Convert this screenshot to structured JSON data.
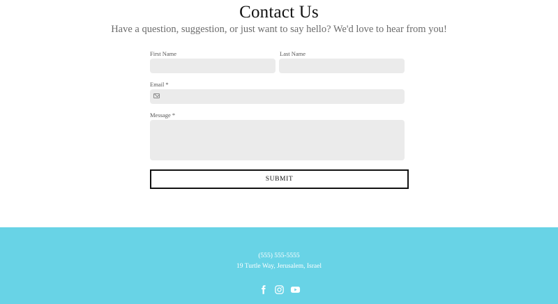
{
  "header": {
    "title": "Contact Us",
    "subtitle": "Have a question, suggestion, or just want to say hello? We'd love to hear from you!"
  },
  "form": {
    "first_name_label": "First Name",
    "first_name_value": "",
    "last_name_label": "Last Name",
    "last_name_value": "",
    "email_label": "Email *",
    "email_value": "",
    "message_label": "Message *",
    "message_value": "",
    "submit_label": "SUBMIT"
  },
  "footer": {
    "phone": "(555) 555-5555",
    "address": "19 Turtle Way, Jerusalem, Israel",
    "social_icons": [
      "facebook-icon",
      "instagram-icon",
      "youtube-icon"
    ],
    "background_color": "#68d3e6"
  }
}
